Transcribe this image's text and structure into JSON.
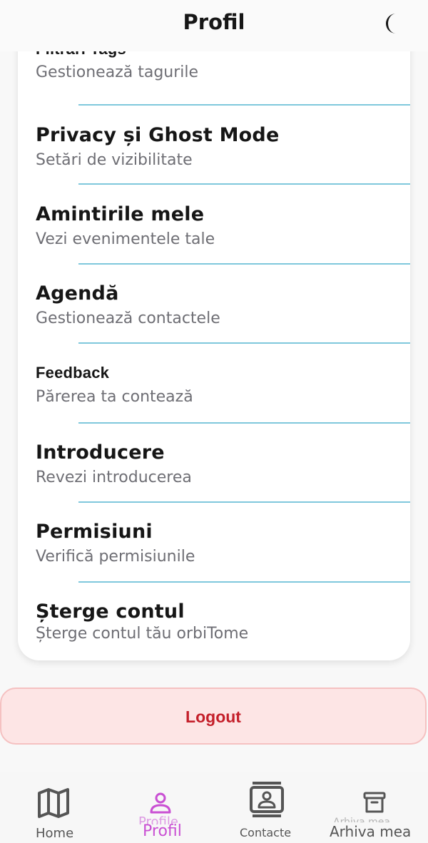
{
  "header": {
    "title": "Profil",
    "theme_icon": "moon-icon"
  },
  "menu": {
    "items": [
      {
        "title": "Filtrări Tags",
        "subtitle": "Gestionează tagurile"
      },
      {
        "title": "Privacy și Ghost Mode",
        "subtitle": "Setări de vizibilitate"
      },
      {
        "title": "Amintirile mele",
        "subtitle": "Vezi evenimentele tale"
      },
      {
        "title": "Agendă",
        "subtitle": "Gestionează contactele"
      },
      {
        "title": "Feedback",
        "subtitle": "Părerea ta contează"
      },
      {
        "title": "Introducere",
        "subtitle": "Revezi introducerea"
      },
      {
        "title": "Permisiuni",
        "subtitle": "Verifică permisiunile"
      },
      {
        "title": "Șterge contul",
        "subtitle": "Șterge contul tău orbiTome"
      }
    ]
  },
  "logout": {
    "label": "Logout"
  },
  "nav": {
    "home": {
      "label": "Home",
      "icon": "map-icon"
    },
    "profile": {
      "label": "Profil",
      "ghost_label": "Profile",
      "icon": "person-icon"
    },
    "contacts": {
      "label": "Contacte",
      "icon": "contacts-icon"
    },
    "archive": {
      "label": "Arhiva mea",
      "ghost_label": "Arhiva mea",
      "icon": "archive-icon"
    }
  },
  "colors": {
    "accent": "#c94fd3",
    "divider": "#7fc8dc",
    "logout_text": "#c41f2a",
    "logout_bg": "#fde5e5",
    "nav_inactive": "#555555"
  }
}
